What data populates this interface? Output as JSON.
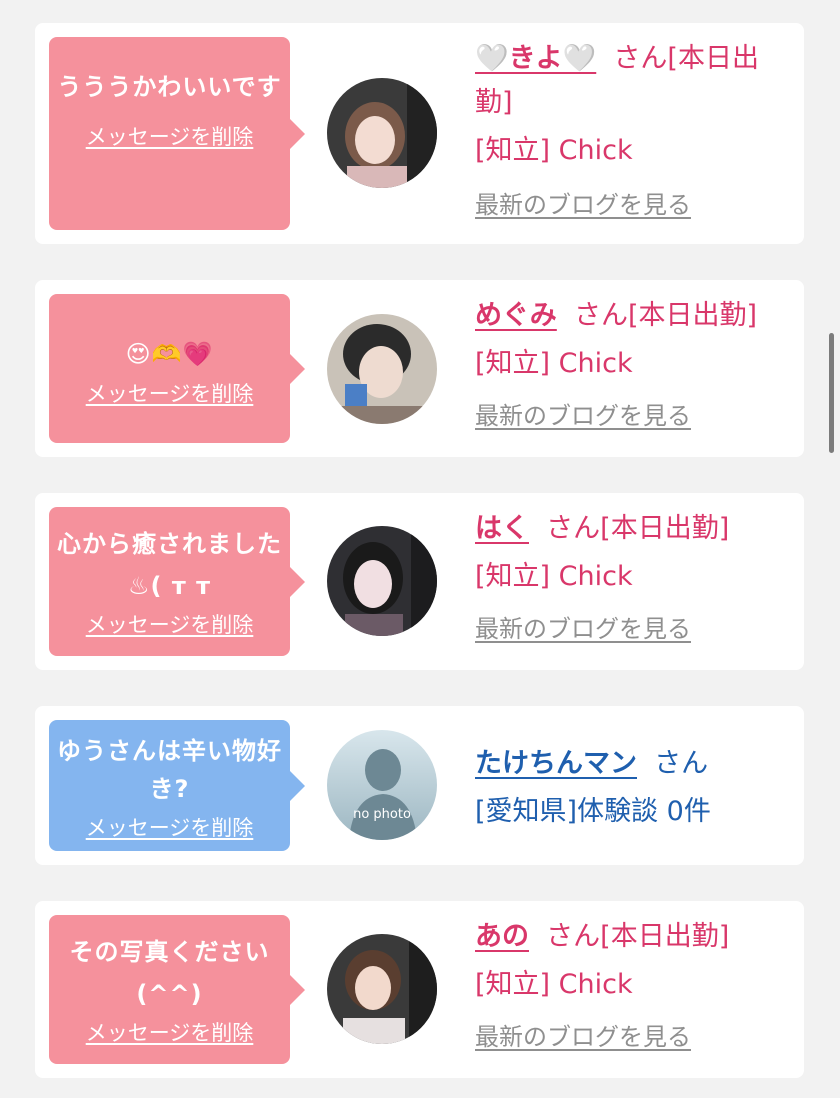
{
  "cards": [
    {
      "message": "うううかわいいです",
      "delete_label": "メッセージを削除",
      "name": "🤍きよ🤍",
      "name_suffix": "さん[本日出勤]",
      "area": "[知立] Chick",
      "blog_link": "最新のブログを見る"
    },
    {
      "message": "😍🫶💗",
      "delete_label": "メッセージを削除",
      "name": "めぐみ",
      "name_suffix": "さん[本日出勤]",
      "area": "[知立] Chick",
      "blog_link": "最新のブログを見る"
    },
    {
      "message": "心から癒されました♨( ᴛ ᴛ",
      "delete_label": "メッセージを削除",
      "name": "はく",
      "name_suffix": "さん[本日出勤]",
      "area": "[知立] Chick",
      "blog_link": "最新のブログを見る"
    },
    {
      "message": "ゆうさんは辛い物好き?",
      "delete_label": "メッセージを削除",
      "name": "たけちんマン",
      "name_suffix": "さん",
      "area": "[愛知県]体験談 0件",
      "avatar_text": "no photo"
    },
    {
      "message": "その写真ください(^^)",
      "delete_label": "メッセージを削除",
      "name": "あの",
      "name_suffix": "さん[本日出勤]",
      "area": "[知立] Chick",
      "blog_link": "最新のブログを見る"
    }
  ],
  "colors": {
    "pink_bubble": "#f5919c",
    "blue_bubble": "#84b5ef",
    "pink_text": "#d9376a",
    "blue_text": "#1f5fae"
  }
}
